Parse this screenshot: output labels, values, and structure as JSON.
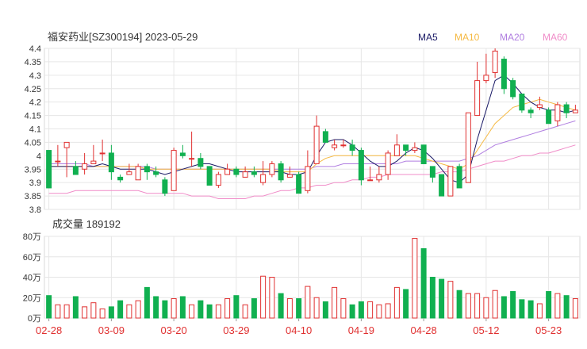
{
  "chart_data": {
    "type": "candlestick",
    "title": "福安药业[SZ300194] 2023-05-29",
    "legend": [
      {
        "name": "MA5",
        "color": "#1a1a66"
      },
      {
        "name": "MA10",
        "color": "#f5b942"
      },
      {
        "name": "MA20",
        "color": "#b07ee0"
      },
      {
        "name": "MA60",
        "color": "#f08cc8"
      }
    ],
    "up_color": "#e03030",
    "down_color": "#10b050",
    "price_axis": {
      "min": 3.8,
      "max": 4.4,
      "ticks": [
        4.4,
        4.35,
        4.3,
        4.25,
        4.2,
        4.15,
        4.1,
        4.05,
        4,
        3.95,
        3.9,
        3.85,
        3.8
      ],
      "tick_labels": [
        "4.4",
        "4.35",
        "4.3",
        "4.25",
        "4.2",
        "4.15",
        "4.1",
        "4.05",
        "4",
        "3.95",
        "3.9",
        "3.85",
        "3.8"
      ]
    },
    "volume_title": "成交量 189192",
    "volume_axis": {
      "min": 0,
      "max": 80,
      "ticks": [
        80,
        60,
        40,
        20,
        0
      ],
      "tick_labels": [
        "80万",
        "60万",
        "40万",
        "20万",
        "0万"
      ]
    },
    "x_ticks": [
      {
        "index": 0,
        "label": "02-28"
      },
      {
        "index": 7,
        "label": "03-09"
      },
      {
        "index": 14,
        "label": "03-20"
      },
      {
        "index": 21,
        "label": "03-29"
      },
      {
        "index": 28,
        "label": "04-10"
      },
      {
        "index": 35,
        "label": "04-19"
      },
      {
        "index": 42,
        "label": "04-28"
      },
      {
        "index": 49,
        "label": "05-12"
      },
      {
        "index": 56,
        "label": "05-23"
      }
    ],
    "ohlc": [
      [
        4.02,
        3.88,
        4.02,
        3.89
      ],
      [
        3.98,
        3.98,
        4.04,
        3.96
      ],
      [
        4.03,
        4.05,
        4.05,
        3.92
      ],
      [
        3.96,
        3.93,
        3.98,
        3.93
      ],
      [
        3.95,
        3.97,
        4.01,
        3.93
      ],
      [
        3.97,
        3.98,
        4.04,
        3.97
      ],
      [
        4.01,
        4.01,
        4.06,
        3.98
      ],
      [
        4.01,
        3.94,
        4.04,
        3.91
      ],
      [
        3.92,
        3.91,
        3.93,
        3.9
      ],
      [
        3.93,
        3.94,
        3.97,
        3.93
      ],
      [
        3.91,
        3.96,
        3.97,
        3.91
      ],
      [
        3.96,
        3.94,
        3.97,
        3.91
      ],
      [
        3.94,
        3.93,
        3.96,
        3.92
      ],
      [
        3.91,
        3.86,
        3.92,
        3.85
      ],
      [
        3.87,
        4.02,
        4.03,
        3.87
      ],
      [
        4.01,
        4.0,
        4.04,
        3.99
      ],
      [
        3.99,
        3.99,
        4.09,
        3.96
      ],
      [
        3.99,
        3.96,
        4.01,
        3.95
      ],
      [
        3.96,
        3.89,
        3.96,
        3.89
      ],
      [
        3.89,
        3.93,
        3.94,
        3.88
      ],
      [
        3.93,
        3.95,
        3.97,
        3.93
      ],
      [
        3.95,
        3.93,
        3.96,
        3.92
      ],
      [
        3.92,
        3.94,
        3.96,
        3.92
      ],
      [
        3.94,
        3.93,
        3.96,
        3.92
      ],
      [
        3.9,
        3.93,
        3.98,
        3.89
      ],
      [
        3.93,
        3.97,
        3.98,
        3.92
      ],
      [
        3.97,
        3.91,
        3.98,
        3.9
      ],
      [
        3.92,
        3.93,
        3.96,
        3.92
      ],
      [
        3.93,
        3.86,
        3.94,
        3.86
      ],
      [
        3.87,
        3.96,
        4.02,
        3.86
      ],
      [
        3.97,
        4.11,
        4.15,
        3.97
      ],
      [
        4.09,
        4.05,
        4.1,
        4.05
      ],
      [
        4.03,
        4.04,
        4.06,
        4.02
      ],
      [
        4.04,
        4.04,
        4.06,
        4.03
      ],
      [
        4.04,
        4.02,
        4.06,
        4.0
      ],
      [
        4.02,
        3.91,
        4.03,
        3.89
      ],
      [
        3.91,
        3.91,
        3.96,
        3.91
      ],
      [
        3.91,
        3.93,
        3.96,
        3.9
      ],
      [
        3.93,
        4.01,
        4.02,
        3.91
      ],
      [
        4.0,
        4.04,
        4.08,
        4.0
      ],
      [
        4.04,
        4.02,
        4.04,
        4.0
      ],
      [
        4.02,
        4.03,
        4.05,
        4.01
      ],
      [
        4.04,
        3.97,
        4.04,
        3.97
      ],
      [
        3.96,
        3.92,
        3.96,
        3.9
      ],
      [
        3.93,
        3.85,
        3.92,
        3.85
      ],
      [
        3.85,
        3.96,
        3.96,
        3.85
      ],
      [
        3.96,
        3.88,
        3.97,
        3.88
      ],
      [
        3.9,
        4.16,
        4.16,
        3.91
      ],
      [
        4.15,
        4.28,
        4.35,
        4.15
      ],
      [
        4.28,
        4.3,
        4.38,
        4.27
      ],
      [
        4.31,
        4.39,
        4.4,
        4.29
      ],
      [
        4.36,
        4.25,
        4.37,
        4.23
      ],
      [
        4.28,
        4.22,
        4.29,
        4.21
      ],
      [
        4.23,
        4.17,
        4.23,
        4.16
      ],
      [
        4.17,
        4.16,
        4.18,
        4.14
      ],
      [
        4.18,
        4.19,
        4.22,
        4.17
      ],
      [
        4.17,
        4.12,
        4.18,
        4.12
      ],
      [
        4.13,
        4.19,
        4.2,
        4.11
      ],
      [
        4.19,
        4.16,
        4.2,
        4.14
      ],
      [
        4.16,
        4.17,
        4.19,
        4.16
      ]
    ],
    "ma5": [
      3.96,
      3.96,
      3.96,
      3.96,
      3.96,
      3.96,
      3.97,
      3.96,
      3.95,
      3.95,
      3.95,
      3.95,
      3.94,
      3.93,
      3.94,
      3.95,
      3.96,
      3.97,
      3.97,
      3.96,
      3.95,
      3.94,
      3.94,
      3.94,
      3.94,
      3.94,
      3.94,
      3.93,
      3.93,
      3.94,
      4.0,
      4.05,
      4.06,
      4.06,
      4.04,
      4.01,
      3.98,
      3.96,
      3.96,
      3.98,
      4.01,
      4.03,
      4.02,
      3.99,
      3.95,
      3.91,
      3.9,
      3.93,
      4.06,
      4.17,
      4.28,
      4.3,
      4.27,
      4.23,
      4.2,
      4.18,
      4.17,
      4.17,
      4.16,
      4.17
    ],
    "ma10": [
      3.96,
      3.96,
      3.96,
      3.96,
      3.96,
      3.96,
      3.96,
      3.96,
      3.96,
      3.96,
      3.96,
      3.95,
      3.95,
      3.95,
      3.95,
      3.95,
      3.95,
      3.95,
      3.95,
      3.95,
      3.95,
      3.95,
      3.95,
      3.95,
      3.95,
      3.95,
      3.94,
      3.94,
      3.94,
      3.94,
      3.97,
      3.99,
      4.0,
      4.0,
      4.0,
      4.0,
      4.0,
      4.0,
      4.0,
      4.0,
      4.0,
      4.0,
      3.99,
      3.98,
      3.97,
      3.96,
      3.95,
      3.97,
      4.02,
      4.07,
      4.12,
      4.15,
      4.18,
      4.19,
      4.2,
      4.21,
      4.2,
      4.19,
      4.18,
      4.17
    ],
    "ma20": [
      3.97,
      3.97,
      3.97,
      3.97,
      3.97,
      3.96,
      3.96,
      3.96,
      3.96,
      3.96,
      3.96,
      3.96,
      3.95,
      3.95,
      3.95,
      3.95,
      3.95,
      3.95,
      3.95,
      3.95,
      3.95,
      3.95,
      3.95,
      3.95,
      3.95,
      3.95,
      3.95,
      3.95,
      3.95,
      3.95,
      3.96,
      3.96,
      3.96,
      3.97,
      3.97,
      3.97,
      3.97,
      3.97,
      3.97,
      3.97,
      3.98,
      3.98,
      3.98,
      3.98,
      3.98,
      3.98,
      3.98,
      3.99,
      4.0,
      4.02,
      4.04,
      4.05,
      4.06,
      4.07,
      4.08,
      4.09,
      4.1,
      4.11,
      4.12,
      4.13
    ],
    "ma60": [
      3.86,
      3.86,
      3.86,
      3.87,
      3.87,
      3.87,
      3.87,
      3.87,
      3.87,
      3.87,
      3.87,
      3.86,
      3.86,
      3.86,
      3.86,
      3.86,
      3.85,
      3.85,
      3.85,
      3.84,
      3.84,
      3.84,
      3.84,
      3.85,
      3.85,
      3.86,
      3.87,
      3.87,
      3.88,
      3.88,
      3.89,
      3.89,
      3.9,
      3.9,
      3.91,
      3.91,
      3.92,
      3.92,
      3.93,
      3.93,
      3.93,
      3.93,
      3.93,
      3.93,
      3.94,
      3.94,
      3.94,
      3.95,
      3.96,
      3.97,
      3.98,
      3.98,
      3.99,
      4.0,
      4.0,
      4.01,
      4.01,
      4.02,
      4.03,
      4.04
    ],
    "volume": [
      22,
      13,
      13,
      21,
      11,
      15,
      9,
      11,
      17,
      13,
      17,
      30,
      21,
      17,
      19,
      21,
      13,
      17,
      13,
      13,
      19,
      22,
      13,
      19,
      41,
      40,
      24,
      19,
      19,
      31,
      20,
      16,
      30,
      19,
      13,
      16,
      16,
      13,
      14,
      30,
      28,
      78,
      68,
      40,
      38,
      36,
      27,
      24,
      24,
      20,
      27,
      21,
      26,
      18,
      17,
      14,
      26,
      24,
      22,
      19
    ]
  }
}
